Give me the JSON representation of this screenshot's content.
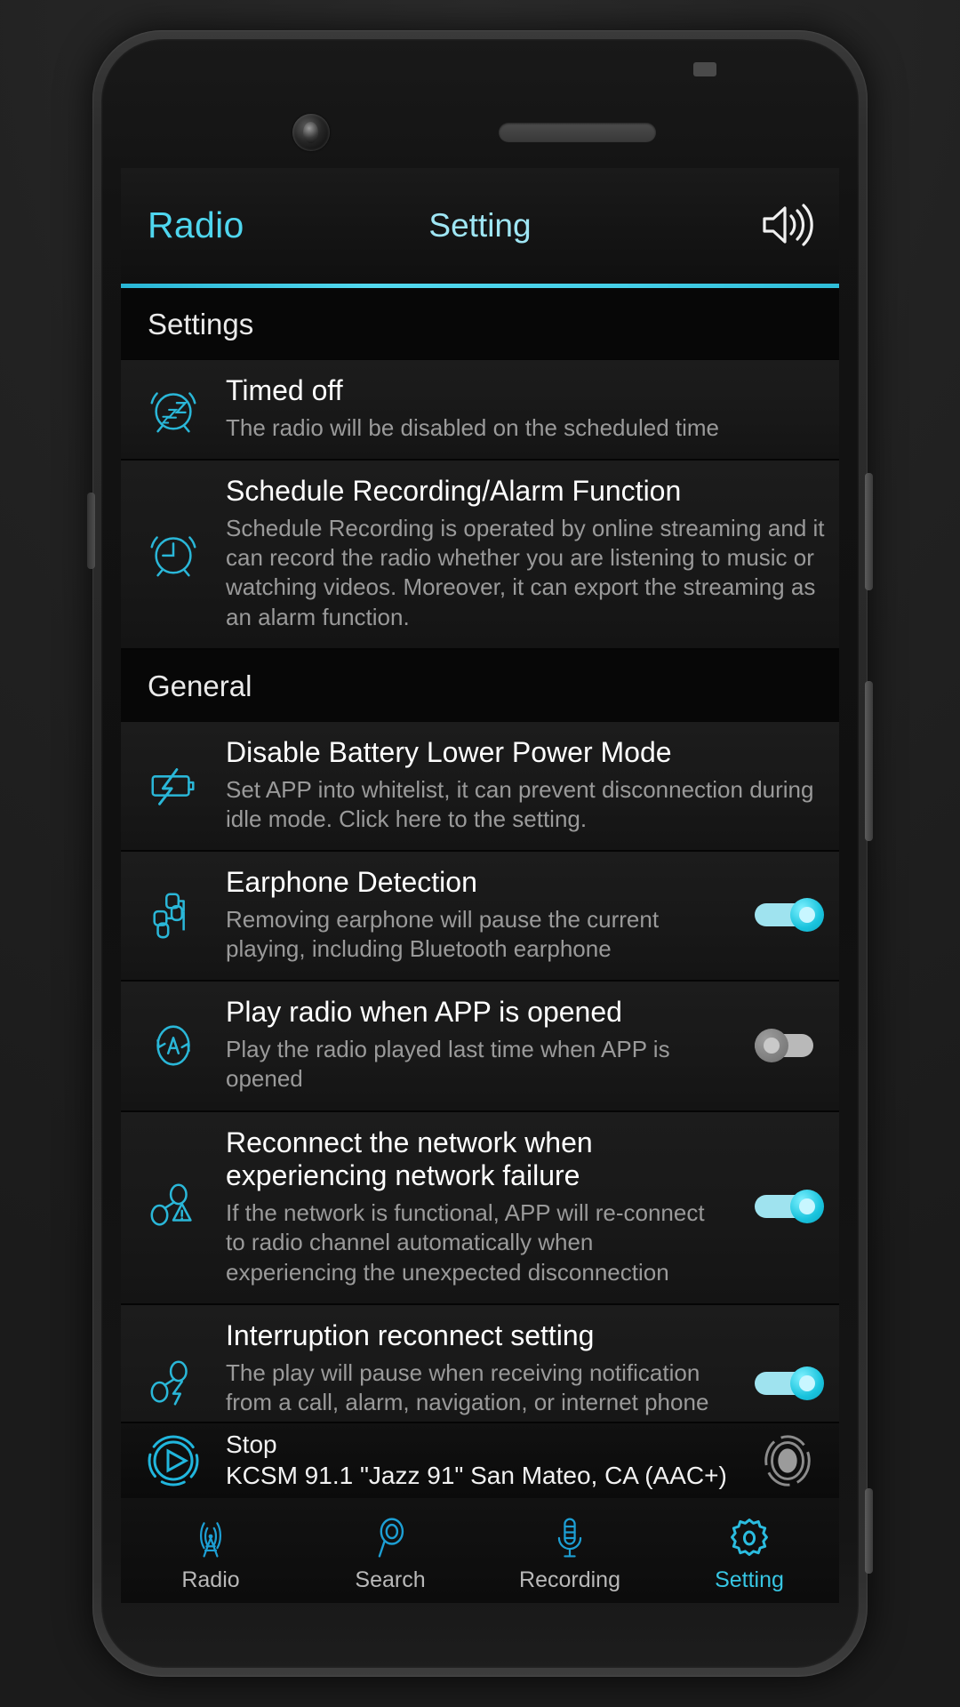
{
  "accent_color": "#3bc8e2",
  "header": {
    "left_title": "Radio",
    "center_title": "Setting",
    "volume_icon": "speaker-volume-icon"
  },
  "sections": [
    {
      "title": "Settings",
      "rows": [
        {
          "icon": "alarm-sleep-icon",
          "title": "Timed off",
          "subtitle": "The radio will be disabled on the scheduled time",
          "toggle": null
        },
        {
          "icon": "alarm-clock-icon",
          "title": "Schedule Recording/Alarm Function",
          "subtitle": "Schedule Recording is operated by online streaming and it can record the radio whether you are listening to music or watching videos. Moreover, it can export the streaming as an alarm function.",
          "toggle": null
        }
      ]
    },
    {
      "title": "General",
      "rows": [
        {
          "icon": "battery-bolt-icon",
          "title": "Disable Battery Lower Power Mode",
          "subtitle": "Set APP into whitelist, it can prevent disconnection during idle mode. Click here to the setting.",
          "toggle": null
        },
        {
          "icon": "earphone-icon",
          "title": "Earphone Detection",
          "subtitle": "Removing earphone will pause the current playing, including Bluetooth earphone",
          "toggle": "on"
        },
        {
          "icon": "auto-play-icon",
          "title": "Play radio when APP is opened",
          "subtitle": "Play the radio played last time when APP is opened",
          "toggle": "off"
        },
        {
          "icon": "network-warning-icon",
          "title": "Reconnect the network when experiencing network failure",
          "subtitle": "If the network is functional, APP will re-connect to radio channel automatically when experiencing the unexpected disconnection",
          "toggle": "on"
        },
        {
          "icon": "network-bolt-icon",
          "title": "Interruption reconnect setting",
          "subtitle": "The play will pause when receiving notification from a call, alarm, navigation, or internet phone and it will resume after notification.",
          "toggle": "on"
        }
      ]
    }
  ],
  "player": {
    "play_icon": "play-circle-icon",
    "status": "Stop",
    "station": "KCSM 91.1  \"Jazz 91\" San Mateo, CA (AAC+)",
    "record_icon": "record-button-icon"
  },
  "nav": {
    "items": [
      {
        "label": "Radio",
        "icon": "antenna-tower-icon",
        "active": false
      },
      {
        "label": "Search",
        "icon": "magnifier-icon",
        "active": false
      },
      {
        "label": "Recording",
        "icon": "microphone-icon",
        "active": false
      },
      {
        "label": "Setting",
        "icon": "gear-icon",
        "active": true
      }
    ]
  }
}
